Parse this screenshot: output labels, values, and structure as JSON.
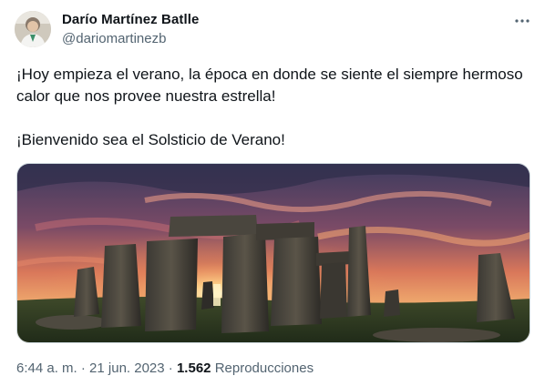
{
  "author": {
    "name": "Darío Martínez Batlle",
    "handle": "@dariomartinezb"
  },
  "icons": {
    "avatar": "avatar-photo",
    "more": "more-horizontal-icon"
  },
  "tweet": {
    "paragraph_1": "¡Hoy empieza el verano, la época en donde se siente el siempre hermoso calor que nos provee nuestra estrella!",
    "paragraph_2": "¡Bienvenido sea el Solsticio de Verano!"
  },
  "meta": {
    "time": "6:44 a. m.",
    "sep_1": "·",
    "date": "21 jun. 2023",
    "sep_2": "·",
    "views_count": "1.562",
    "views_label": "Reproducciones"
  },
  "colors": {
    "text_primary": "#0f1419",
    "text_secondary": "#536471",
    "border": "#cfd9de"
  }
}
